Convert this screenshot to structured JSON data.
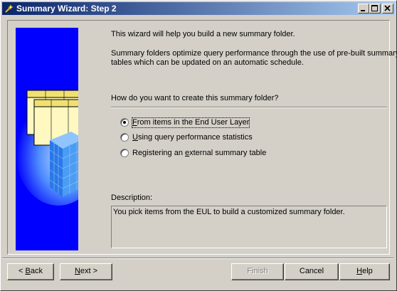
{
  "window": {
    "title": "Summary Wizard: Step 2",
    "title_icon": "wizard-icon",
    "controls": [
      "minimize-icon",
      "maximize-icon",
      "close-icon"
    ]
  },
  "intro": {
    "line1": "This wizard will help you build a new summary folder.",
    "line2a": "Summary folders optimize query performance through the use of pre-built summary",
    "line2b": "tables which can be updated on an automatic schedule."
  },
  "question": "How do you want to create this summary folder?",
  "options": [
    {
      "pre": "",
      "ul": "F",
      "post": "rom items in the End User Layer",
      "selected": true
    },
    {
      "pre": "",
      "ul": "U",
      "post": "sing query performance statistics",
      "selected": false
    },
    {
      "pre": "Registering an ",
      "ul": "e",
      "post": "xternal summary table",
      "selected": false
    }
  ],
  "description": {
    "label": "Description:",
    "text": "You pick items from the EUL to build a customized summary folder."
  },
  "buttons": {
    "back": {
      "pre": "< ",
      "ul": "B",
      "post": "ack"
    },
    "next": {
      "pre": "",
      "ul": "N",
      "post": "ext >"
    },
    "finish": {
      "label": "Finish",
      "enabled": false
    },
    "cancel": {
      "label": "Cancel"
    },
    "help": {
      "pre": "",
      "ul": "H",
      "post": "elp"
    }
  },
  "colors": {
    "title_start": "#0a246a",
    "title_end": "#a6caf0",
    "graphic_blue": "#0000ff",
    "face": "#d4d0c8"
  }
}
